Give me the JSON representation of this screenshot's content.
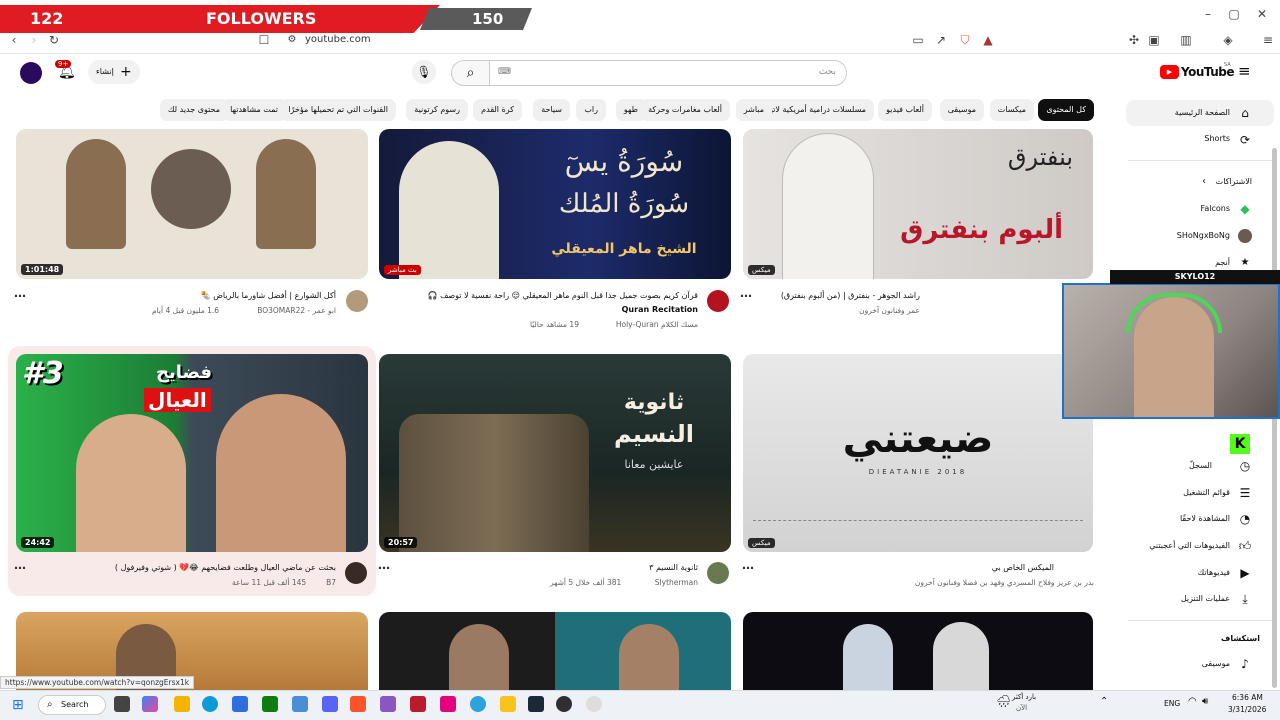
{
  "overlay": {
    "left_count": "122",
    "label": "FOLLOWERS",
    "right_count": "150"
  },
  "browser": {
    "url": "youtube.com"
  },
  "header": {
    "logo_text": "YouTube",
    "logo_region": "SA",
    "search_placeholder": "بحث",
    "create_label": "إنشاء",
    "notif_count": "9+"
  },
  "chips": [
    "كل المحتوى",
    "ميكسات",
    "موسيقى",
    "ألعاب فيديو",
    "مسلسلات درامية أمريكية لاتينية",
    "مباشر",
    "ألعاب مغامرات وحركة",
    "طهو",
    "راب",
    "سياحة",
    "كرة القدم",
    "رسوم كرتونية",
    "القنوات التي تم تحميلها مؤخرًا",
    "تمت مشاهدتها",
    "محتوى جديد لك"
  ],
  "sidebar": {
    "home": "الصفحة الرئيسية",
    "shorts": "Shorts",
    "subscriptions": "الاشتراكات",
    "subs": [
      "Falcons",
      "SHoNgxBoNg",
      "أنجم"
    ],
    "history": "السجلّ",
    "playlists": "قوائم التشغيل",
    "watch_later": "المشاهدة لاحقًا",
    "liked": "الفيديوهات التي أعجبتني",
    "your_videos": "فيديوهاتك",
    "downloads": "عمليات التنزيل",
    "explore": "استكشاف",
    "music": "موسيقى"
  },
  "videos": [
    {
      "title": "أكل الشوارع | أفضل شاورما بالرياض 🌯",
      "channel": "ابو عمر - BO3OMAR22",
      "meta": "1.6 مليون  قبل 4 أيام",
      "duration": "1:01:48"
    },
    {
      "title": "قرآن كريم بصوت جميل جدا قبل النوم ماهر المعيقلي 😌 راحة نفسية لا توصف 🎧",
      "channel": "Quran Recitation",
      "channel2": "مسك الكلام Holy-Quran",
      "meta": "19 مشاهد حاليًا",
      "badge": "بث مباشر",
      "thumb_text1": "سُورَةُ يسٓ",
      "thumb_text2": "سُورَةُ المُلك",
      "thumb_text3": "الشيخ ماهر المعيقلي"
    },
    {
      "title": "راشد الجوهر - بنفترق | (من ألبوم بنفترق)",
      "channel": "عمر وفنانون آخرون",
      "badge": "ميكس",
      "thumb_text1": "بنفترق",
      "thumb_text2": "ألبوم بنفترق"
    },
    {
      "title": "بحثت عن ماضي العيال وطلعت فضايحهم 😂💔 ( شوتي وفيرفول )",
      "channel": "B7",
      "meta": "145 ألف  قبل 11 ساعة",
      "duration": "24:42",
      "thumb_text1": "#3",
      "thumb_text2": "فضايح",
      "thumb_text3": "العيال"
    },
    {
      "title": "ثانوية النسيم ٣",
      "channel": "Slytherman",
      "meta": "381 ألف  خلال 5 أشهر",
      "duration": "20:57",
      "thumb_text1": "ثانوية",
      "thumb_text2": "النسيم",
      "thumb_text3": "عايشين معانا"
    },
    {
      "title": "الميكس الخاص بي",
      "channel": "بدر بن عزيز وفلاح المسردي وفهد بن فصلا وفنانون آخرون",
      "badge": "ميكس",
      "thumb_text1": "ضيعتني",
      "thumb_text2": "DIEATANIE 2018"
    }
  ],
  "webcam": {
    "name": "SKYLO12"
  },
  "status_url": "https://www.youtube.com/watch?v=qonzgErsx1k",
  "taskbar": {
    "search": "Search",
    "weather": "بارد أكثر",
    "weather2": "الآن",
    "lang": "ENG",
    "time": "6:36 AM",
    "date": "3/31/2026"
  }
}
